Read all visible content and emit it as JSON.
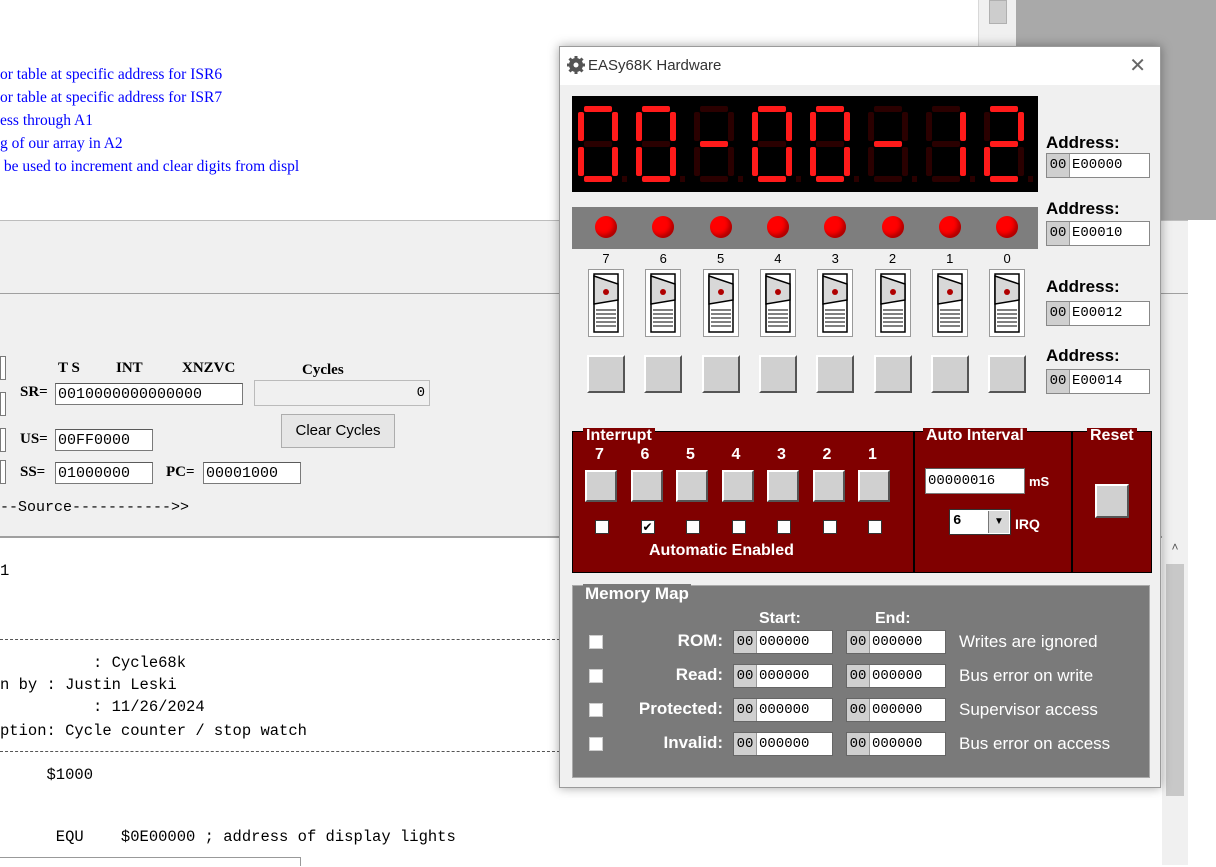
{
  "editor": {
    "code_lines": [
      "or table at specific address for ISR6",
      "or table at specific address for ISR7",
      "ess through A1",
      "g of our array in A2",
      " be used to increment and clear digits from displ"
    ]
  },
  "simulator": {
    "headers": {
      "ts": "T S",
      "int": "INT",
      "flags": "XNZVC",
      "cycles": "Cycles"
    },
    "sr_label": "SR=",
    "sr_value": "0010000000000000",
    "cycles_value": "0",
    "us_label": "US=",
    "us_value": "00FF0000",
    "ss_label": "SS=",
    "ss_value": "01000000",
    "pc_label": "PC=",
    "pc_value": "00001000",
    "clear_cycles_label": "Clear Cycles",
    "source_label": "--Source----------->>",
    "source_lines": {
      "l1": "1",
      "title": "          : Cycle68k",
      "written": "n by : Justin Leski",
      "date": "          : 11/26/2024",
      "desc": "ption: Cycle counter / stop watch",
      "org": "     $1000",
      "equ": "      EQU    $0E00000 ; address of display lights"
    }
  },
  "hardware": {
    "title": "EASy68K Hardware",
    "close_glyph": "✕",
    "segment_chars": [
      "0",
      "0",
      "-",
      "0",
      "0",
      "-",
      "1",
      "2"
    ],
    "address_label": "Address:",
    "addresses": [
      {
        "hi": "00",
        "lo": "E00000"
      },
      {
        "hi": "00",
        "lo": "E00010"
      },
      {
        "hi": "00",
        "lo": "E00012"
      },
      {
        "hi": "00",
        "lo": "E00014"
      }
    ],
    "switch_numbers": [
      "7",
      "6",
      "5",
      "4",
      "3",
      "2",
      "1",
      "0"
    ],
    "interrupt_label": "Interrupt",
    "interrupt_numbers": [
      "7",
      "6",
      "5",
      "4",
      "3",
      "2",
      "1"
    ],
    "interrupt_checked": [
      false,
      true,
      false,
      false,
      false,
      false,
      false
    ],
    "automatic_enabled_label": "Automatic Enabled",
    "auto_interval_label": "Auto Interval",
    "interval_value": "00000016",
    "interval_unit": "mS",
    "irq_value": "6",
    "irq_label": "IRQ",
    "reset_label": "Reset",
    "memory_map_label": "Memory Map",
    "start_label": "Start:",
    "end_label": "End:",
    "memory_rows": [
      {
        "label": "ROM:",
        "start_hi": "00",
        "start": "000000",
        "end_hi": "00",
        "end": "000000",
        "desc": "Writes are ignored"
      },
      {
        "label": "Read:",
        "start_hi": "00",
        "start": "000000",
        "end_hi": "00",
        "end": "000000",
        "desc": "Bus error on write"
      },
      {
        "label": "Protected:",
        "start_hi": "00",
        "start": "000000",
        "end_hi": "00",
        "end": "000000",
        "desc": "Supervisor access"
      },
      {
        "label": "Invalid:",
        "start_hi": "00",
        "start": "000000",
        "end_hi": "00",
        "end": "000000",
        "desc": "Bus error on access"
      }
    ],
    "colors": {
      "segment_on": "#ff1a1a",
      "segment_off": "#2a0000",
      "panel_red": "#800000",
      "led": "#ff0000"
    }
  }
}
